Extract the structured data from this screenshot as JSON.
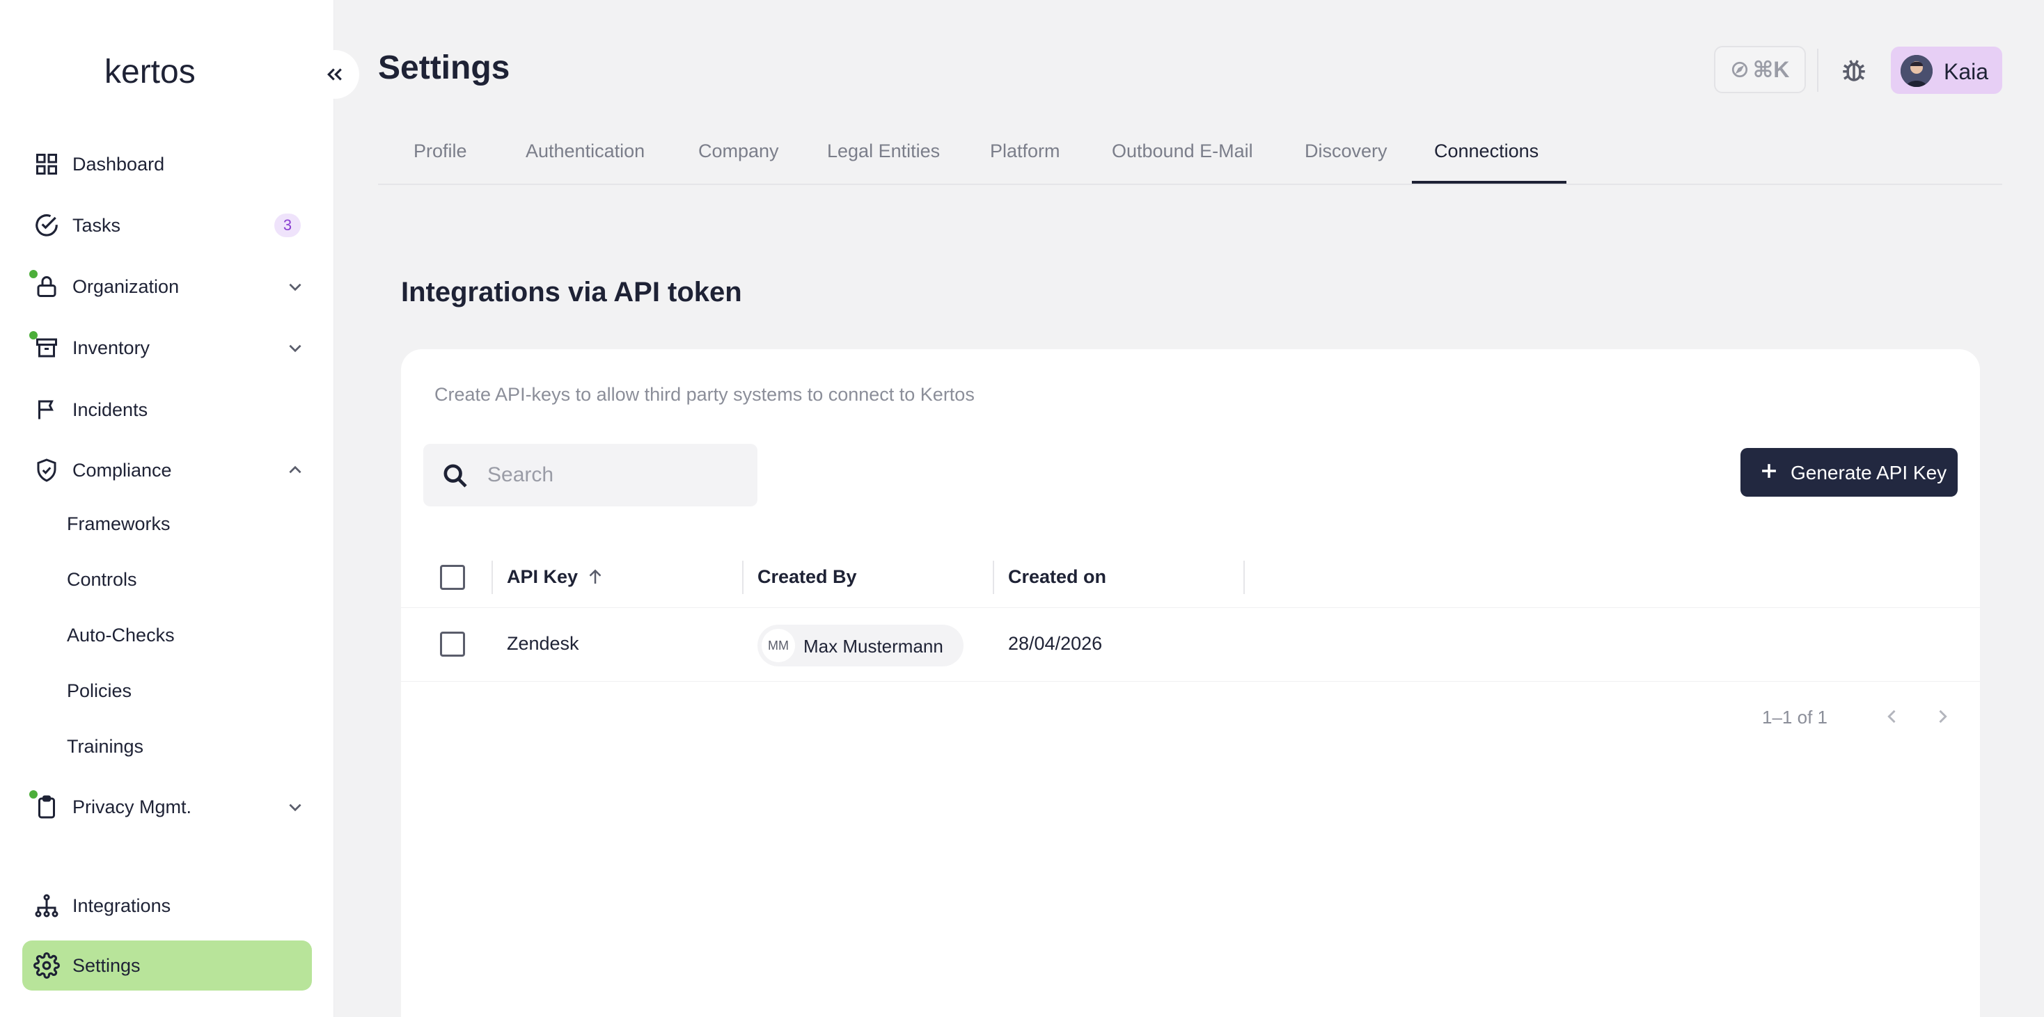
{
  "brand": {
    "logo_text": "kertos"
  },
  "sidebar": {
    "items": [
      {
        "label": "Dashboard"
      },
      {
        "label": "Tasks",
        "badge": "3"
      },
      {
        "label": "Organization"
      },
      {
        "label": "Inventory"
      },
      {
        "label": "Incidents"
      },
      {
        "label": "Compliance"
      },
      {
        "label": "Privacy Mgmt."
      },
      {
        "label": "Integrations"
      },
      {
        "label": "Settings"
      }
    ],
    "compliance_sub": [
      "Frameworks",
      "Controls",
      "Auto-Checks",
      "Policies",
      "Trainings"
    ]
  },
  "header": {
    "title": "Settings",
    "shortcut": "⌘K",
    "user_name": "Kaia"
  },
  "tabs": [
    {
      "label": "Profile"
    },
    {
      "label": "Authentication"
    },
    {
      "label": "Company"
    },
    {
      "label": "Legal Entities"
    },
    {
      "label": "Platform"
    },
    {
      "label": "Outbound E-Mail"
    },
    {
      "label": "Discovery"
    },
    {
      "label": "Connections",
      "active": true
    }
  ],
  "section": {
    "title": "Integrations via API token",
    "description": "Create API-keys to allow third party systems to connect to Kertos",
    "search_placeholder": "Search",
    "generate_label": "Generate API Key"
  },
  "table": {
    "columns": [
      "API Key",
      "Created By",
      "Created on"
    ],
    "rows": [
      {
        "api_key": "Zendesk",
        "created_by": "Max Mustermann",
        "initials": "MM",
        "created_on": "28/04/2026"
      }
    ],
    "pagination": "1–1 of 1"
  },
  "colors": {
    "accent_active": "#b8e49a",
    "primary_button": "#222840",
    "status_dot": "#4cae3a"
  }
}
